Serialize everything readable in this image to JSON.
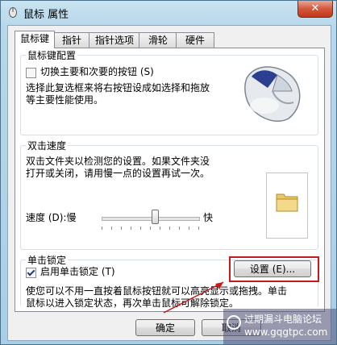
{
  "window": {
    "title": "鼠标 属性",
    "close_label": "✕"
  },
  "tabs": [
    {
      "label": "鼠标键",
      "active": true
    },
    {
      "label": "指针",
      "active": false
    },
    {
      "label": "指针选项",
      "active": false
    },
    {
      "label": "滑轮",
      "active": false
    },
    {
      "label": "硬件",
      "active": false
    }
  ],
  "button_config": {
    "group_label": "鼠标键配置",
    "swap_label": "切换主要和次要的按钮 (S)",
    "swap_checked": false,
    "description_line1": "选择此复选框来将右按钮设成如选择和拖放",
    "description_line2": "等主要性能使用。"
  },
  "double_click": {
    "group_label": "双击速度",
    "description_line1": "双击文件夹以检测您的设置。如果文件夹没",
    "description_line2": "打开或关闭，请用慢一点的设置再试一次。",
    "speed_label": "速度 (D):慢",
    "fast_label": "快",
    "speed_fraction": 0.55
  },
  "click_lock": {
    "group_label": "单击锁定",
    "enable_label": "启用单击锁定 (T)",
    "enable_checked": true,
    "settings_button": "设置 (E)...",
    "description_line1": "使您可以不用一直按着鼠标按钮就可以高亮显示或拖拽。单击",
    "description_line2": "鼠标以进入锁定状态，再次单击鼠标可解除锁定。"
  },
  "footer": {
    "ok_label": "确定",
    "cancel_label": "取消"
  },
  "watermark": {
    "text": "过期漏斗电脑论坛",
    "url": "www.gqgtpc.com"
  },
  "colors": {
    "highlight": "#c71b1b",
    "window_glass": "#a9cfe6"
  }
}
